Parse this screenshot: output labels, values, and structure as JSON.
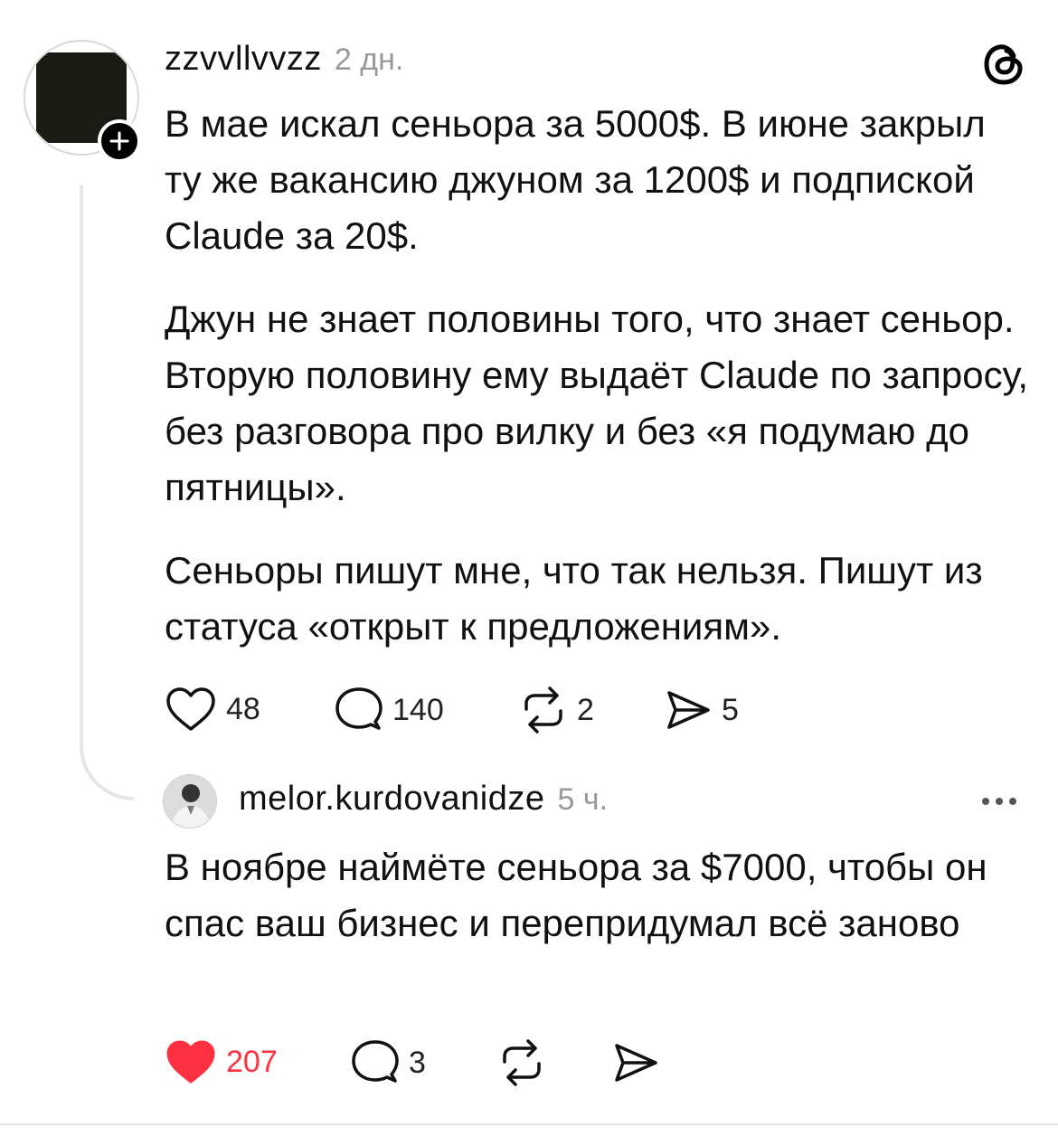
{
  "post": {
    "username": "zzvvllvvzz",
    "time": "2 дн.",
    "paragraphs": [
      "В мае искал сеньора за 5000$. В июне закрыл ту же вакансию джуном за 1200$ и подпиской Claude за 20$.",
      "Джун не знает половины того, что знает сеньор. Вторую половину ему выдаёт Claude по запросу, без разговора про вилку и без «я подумаю до пятницы».",
      "Сеньоры пишут мне, что так нельзя. Пишут из статуса «открыт к предложениям»."
    ],
    "actions": {
      "likes": "48",
      "replies": "140",
      "reposts": "2",
      "shares": "5"
    }
  },
  "reply": {
    "username": "melor.kurdovanidze",
    "time": "5 ч.",
    "text": "В ноябре наймёте сеньора за $7000, чтобы он спас ваш бизнес и перепридумал всё заново",
    "actions": {
      "likes": "207",
      "replies": "3"
    },
    "liked": true
  },
  "colors": {
    "like_active": "#ff3040",
    "meta_gray": "#999999",
    "thread_line": "#e6e6e6"
  },
  "icons": [
    "threads-logo-icon",
    "plus-icon",
    "heart-icon",
    "comment-icon",
    "repost-icon",
    "share-icon",
    "more-icon"
  ]
}
